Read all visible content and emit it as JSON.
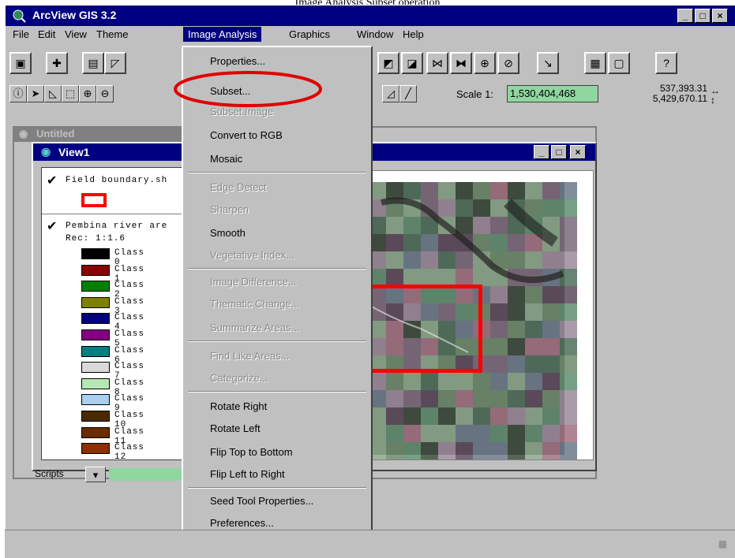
{
  "caption": "Image Analysis Subset operation",
  "window": {
    "title": "ArcView GIS 3.2"
  },
  "menubar": [
    "File",
    "Edit",
    "View",
    "Theme",
    "Image Analysis",
    "Graphics",
    "Window",
    "Help"
  ],
  "toolbar": {
    "scale_label": "Scale 1:",
    "scale_value": "1,530,404,468",
    "coord_x": "537,393.31",
    "coord_y": "5,429,670.11"
  },
  "untitled_window": {
    "title": "Untitled"
  },
  "view_window": {
    "title": "View1"
  },
  "toc": {
    "theme1": {
      "label": "Field boundary.sh"
    },
    "theme2": {
      "label": "Pembina river are",
      "sublabel": "Rec: 1:1.6"
    },
    "classes": [
      {
        "label": "Class 0",
        "color": "#000000"
      },
      {
        "label": "Class 1",
        "color": "#8b0000"
      },
      {
        "label": "Class 2",
        "color": "#008000"
      },
      {
        "label": "Class 3",
        "color": "#808000"
      },
      {
        "label": "Class 4",
        "color": "#000080"
      },
      {
        "label": "Class 5",
        "color": "#800080"
      },
      {
        "label": "Class 6",
        "color": "#008080"
      },
      {
        "label": "Class 7",
        "color": "#d9d9d9"
      },
      {
        "label": "Class 8",
        "color": "#b6e6b6"
      },
      {
        "label": "Class 9",
        "color": "#a8d0f0"
      },
      {
        "label": "Class 10",
        "color": "#4a2a00"
      },
      {
        "label": "Class 11",
        "color": "#6b2a00"
      },
      {
        "label": "Class 12",
        "color": "#8b3000"
      }
    ]
  },
  "scripts": {
    "label": "Scripts"
  },
  "image_analysis_menu": {
    "items": [
      {
        "label": "Properties...",
        "enabled": true
      },
      {
        "label": "Subset...",
        "enabled": true
      },
      {
        "label": "Subset Image",
        "enabled": false
      },
      {
        "label": "Convert to RGB",
        "enabled": true
      },
      {
        "label": "Mosaic",
        "enabled": true
      },
      {
        "label": "Edge Detect",
        "enabled": false
      },
      {
        "label": "Sharpen",
        "enabled": false
      },
      {
        "label": "Smooth",
        "enabled": true
      },
      {
        "label": "Vegetative Index...",
        "enabled": false
      },
      {
        "label": "Image Difference...",
        "enabled": false
      },
      {
        "label": "Thematic Change...",
        "enabled": false
      },
      {
        "label": "Summarize Areas...",
        "enabled": false
      },
      {
        "label": "Find Like Areas...",
        "enabled": false
      },
      {
        "label": "Categorize...",
        "enabled": false
      },
      {
        "label": "Rotate Right",
        "enabled": true
      },
      {
        "label": "Rotate Left",
        "enabled": true
      },
      {
        "label": "Flip Top to Bottom",
        "enabled": true
      },
      {
        "label": "Flip Left to Right",
        "enabled": true
      },
      {
        "label": "Seed Tool Properties...",
        "enabled": true
      },
      {
        "label": "Preferences...",
        "enabled": true
      }
    ]
  },
  "colors": {
    "titlebar": "#000080",
    "face": "#c0c0c0",
    "highlight_ring": "#e00000",
    "subset_box": "#ff0000"
  }
}
